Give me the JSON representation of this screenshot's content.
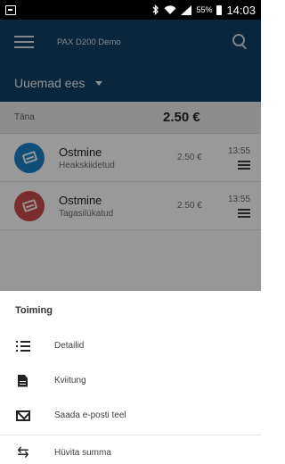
{
  "status_bar": {
    "battery_percent": "55%",
    "time": "14:03",
    "icons": [
      "notification-icon",
      "bluetooth-icon",
      "wifi-icon",
      "signal-icon",
      "battery-icon"
    ]
  },
  "app_bar": {
    "title": "PAX D200 Demo",
    "menu_icon": "hamburger-icon",
    "search_icon": "search-icon"
  },
  "sort": {
    "label": "Uuemad ees"
  },
  "day": {
    "label": "Täna",
    "total": "2.50 €"
  },
  "transactions": [
    {
      "title": "Ostmine",
      "status": "Heakskiidetud",
      "amount": "2.50 €",
      "time": "13:55",
      "color": "#1a7fc4"
    },
    {
      "title": "Ostmine",
      "status": "Tagasilükatud",
      "amount": "2.50 €",
      "time": "13:55",
      "color": "#c44a4a"
    }
  ],
  "sheet": {
    "title": "Toiming",
    "actions": [
      {
        "label": "Detailid",
        "icon": "list-icon"
      },
      {
        "label": "Kviitung",
        "icon": "receipt-icon"
      },
      {
        "label": "Saada e-posti teel",
        "icon": "email-icon"
      },
      {
        "label": "Hüvita summa",
        "icon": "refund-icon"
      }
    ]
  },
  "colors": {
    "app_bar": "#0f3e63",
    "approved": "#1a7fc4",
    "declined": "#c44a4a"
  }
}
